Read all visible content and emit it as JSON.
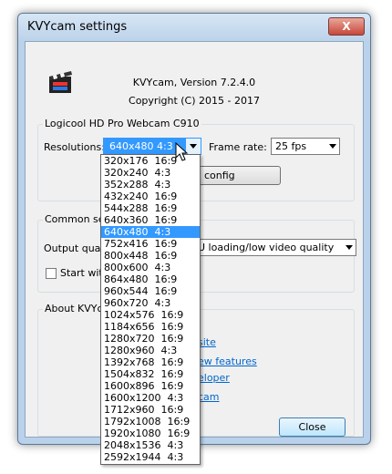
{
  "window": {
    "title": "KVYcam settings",
    "close_glyph": "X"
  },
  "about_header": {
    "version": "KVYcam, Version 7.2.4.0",
    "copyright": "Copyright (C) 2015 - 2017"
  },
  "camera_group": {
    "label": "Logicool HD Pro Webcam C910",
    "resolutions_label": "Resolutions:",
    "resolution_value": "640x480  4:3",
    "frame_rate_label": "Frame rate:",
    "frame_rate_value": "25  fps",
    "config_button": "config"
  },
  "common_group": {
    "label": "Common setti",
    "output_quality_label": "Output qualit",
    "output_quality_value": "U loading/low video quality",
    "start_with_label": "Start with"
  },
  "about_group": {
    "label": "About KVYcan",
    "links": [
      "site",
      "ew features",
      "eloper",
      "cam"
    ]
  },
  "close_button": "Close",
  "resolution_options": [
    "320x176  16:9",
    "320x240  4:3",
    "352x288  4:3",
    "432x240  16:9",
    "544x288  16:9",
    "640x360  16:9",
    "640x480  4:3",
    "752x416  16:9",
    "800x448  16:9",
    "800x600  4:3",
    "864x480  16:9",
    "960x544  16:9",
    "960x720  4:3",
    "1024x576  16:9",
    "1184x656  16:9",
    "1280x720  16:9",
    "1280x960  4:3",
    "1392x768  16:9",
    "1504x832  16:9",
    "1600x896  16:9",
    "1600x1200  4:3",
    "1712x960  16:9",
    "1792x1008  16:9",
    "1920x1080  16:9",
    "2048x1536  4:3",
    "2592x1944  4:3"
  ],
  "selected_resolution_index": 6,
  "colors": {
    "selection": "#3399ff",
    "link": "#0066cc",
    "frame": "#b9d1ea"
  },
  "icons": {
    "app": "clapperboard-icon",
    "cursor": "mouse-pointer-icon"
  }
}
